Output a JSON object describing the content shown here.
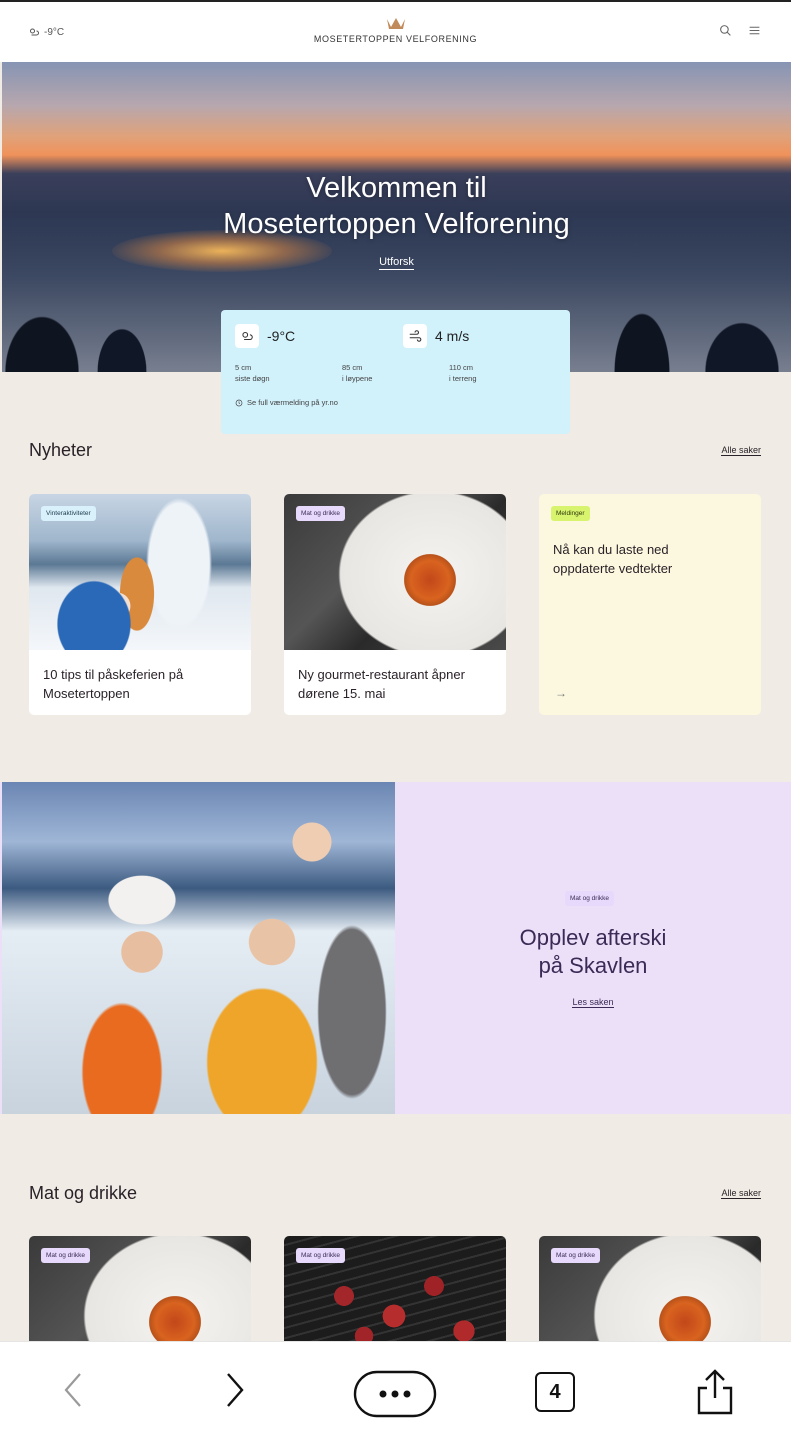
{
  "header": {
    "temp_short": "-9°C",
    "brand": "MOSETERTOPPEN VELFORENING"
  },
  "hero": {
    "title_line1": "Velkommen til",
    "title_line2": "Mosetertoppen Velforening",
    "link": "Utforsk"
  },
  "weather": {
    "temperature": "-9°C",
    "wind": "4 m/s",
    "stats": [
      {
        "value": "5 cm",
        "label": "siste døgn"
      },
      {
        "value": "85 cm",
        "label": "i løypene"
      },
      {
        "value": "110 cm",
        "label": "i terreng"
      }
    ],
    "footer": "Se full værmelding på yr.no"
  },
  "news": {
    "title": "Nyheter",
    "all_link": "Alle saker",
    "cards": [
      {
        "tag": "Vinteraktiviteter",
        "caption_line1": "10 tips til påskeferien på",
        "caption_line2": "Mosetertoppen"
      },
      {
        "tag": "Mat og drikke",
        "caption_line1": "Ny gourmet-restaurant åpner",
        "caption_line2": "dørene 15. mai"
      },
      {
        "tag": "Meldinger",
        "caption_line1": "Nå kan du laste ned",
        "caption_line2": "oppdaterte vedtekter"
      }
    ]
  },
  "feature": {
    "tag": "Mat og drikke",
    "title_line1": "Opplev afterski",
    "title_line2": "på Skavlen",
    "link": "Les saken"
  },
  "food": {
    "title": "Mat og drikke",
    "all_link": "Alle saker",
    "cards": [
      {
        "tag": "Mat og drikke"
      },
      {
        "tag": "Mat og drikke"
      },
      {
        "tag": "Mat og drikke"
      }
    ]
  },
  "browser_bar": {
    "tab_count": "4"
  },
  "colors": {
    "page_bg": "#f1ebe6",
    "weather_card": "#d1f1fb",
    "note_card": "#fbf8df",
    "feature_bg": "#ece0f9",
    "tag_purple": "#e6d9fb",
    "tag_lime": "#d8f36e"
  }
}
